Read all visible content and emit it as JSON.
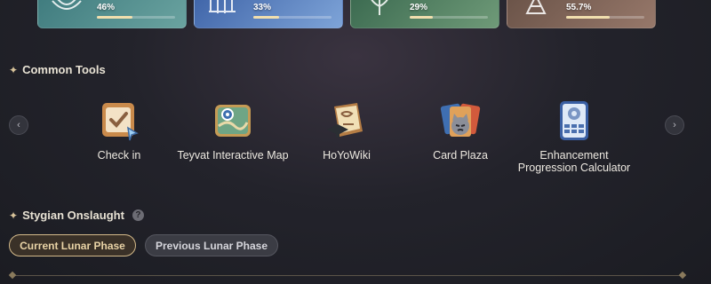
{
  "regions": [
    {
      "percent": "46%",
      "progress": 0.46,
      "colors": [
        "#3f7b7e",
        "#6aa3a0"
      ],
      "emblem": "anemo-emblem-icon"
    },
    {
      "percent": "33%",
      "progress": 0.33,
      "colors": [
        "#3f64a8",
        "#7ea4d8"
      ],
      "emblem": "geo-emblem-icon"
    },
    {
      "percent": "29%",
      "progress": 0.29,
      "colors": [
        "#3b6a50",
        "#6f9a78"
      ],
      "emblem": "dendro-emblem-icon"
    },
    {
      "percent": "55.7%",
      "progress": 0.557,
      "colors": [
        "#6a5348",
        "#97786a"
      ],
      "emblem": "hydro-emblem-icon"
    }
  ],
  "common_tools": {
    "title": "Common Tools",
    "items": [
      {
        "label": "Check in",
        "icon": "check-in-icon"
      },
      {
        "label": "Teyvat Interactive Map",
        "icon": "map-icon"
      },
      {
        "label": "HoYoWiki",
        "icon": "wiki-icon"
      },
      {
        "label": "Card Plaza",
        "icon": "card-plaza-icon"
      },
      {
        "label": "Enhancement Progression Calculator",
        "icon": "calculator-icon"
      }
    ]
  },
  "stygian": {
    "title": "Stygian Onslaught",
    "help": "?",
    "tabs": {
      "current": "Current Lunar Phase",
      "previous": "Previous Lunar Phase"
    }
  },
  "nav": {
    "prev": "‹",
    "next": "›"
  },
  "accent": "#d4ba8a"
}
